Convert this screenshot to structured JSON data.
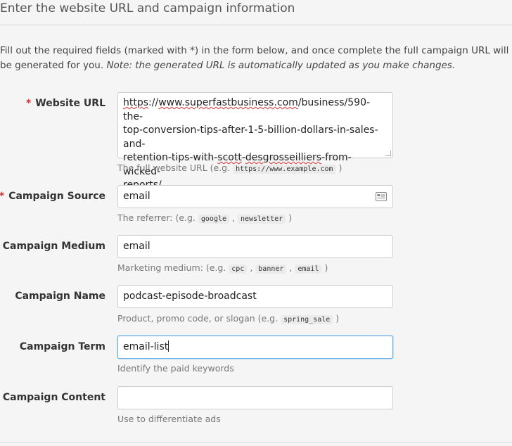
{
  "section": {
    "title": "Enter the website URL and campaign information",
    "intro": "Fill out the required fields (marked with *) in the form below, and once complete the full campaign URL will be generated for you.",
    "note": "Note: the generated URL is automatically updated as you make changes."
  },
  "required_mark": "*",
  "fields": {
    "website_url": {
      "label": "Website URL",
      "required": true,
      "line1_pre": "https",
      "line1_mid": "://",
      "line1_link": "www.superfastbusiness.com",
      "line1_post": "/business/590-the-",
      "line2": "top-conversion-tips-after-1-5-billion-dollars-in-sales-and-",
      "line3_pre": "retention-tips-with-",
      "line3_sq1": "scott",
      "line3_mid": "-",
      "line3_sq2": "desgrosseilliers",
      "line3_post": "-from-wicked-",
      "line4": "reports/",
      "help_prefix": "The full website URL (e.g.",
      "help_code1": "https://www.example.com",
      "help_suffix": ")"
    },
    "campaign_source": {
      "label": "Campaign Source",
      "required": true,
      "value": "email",
      "icon": "autofill-card-icon",
      "help_prefix": "The referrer: (e.g.",
      "help_code1": "google",
      "help_sep1": ",",
      "help_code2": "newsletter",
      "help_suffix": ")"
    },
    "campaign_medium": {
      "label": "Campaign Medium",
      "value": "email",
      "help_prefix": "Marketing medium: (e.g.",
      "help_code1": "cpc",
      "help_sep1": ",",
      "help_code2": "banner",
      "help_sep2": ",",
      "help_code3": "email",
      "help_suffix": ")"
    },
    "campaign_name": {
      "label": "Campaign Name",
      "value": "podcast-episode-broadcast",
      "help_prefix": "Product, promo code, or slogan (e.g.",
      "help_code1": "spring_sale",
      "help_suffix": ")"
    },
    "campaign_term": {
      "label": "Campaign Term",
      "value": "email-list",
      "help": "Identify the paid keywords"
    },
    "campaign_content": {
      "label": "Campaign Content",
      "value": "",
      "help": "Use to differentiate ads"
    }
  }
}
